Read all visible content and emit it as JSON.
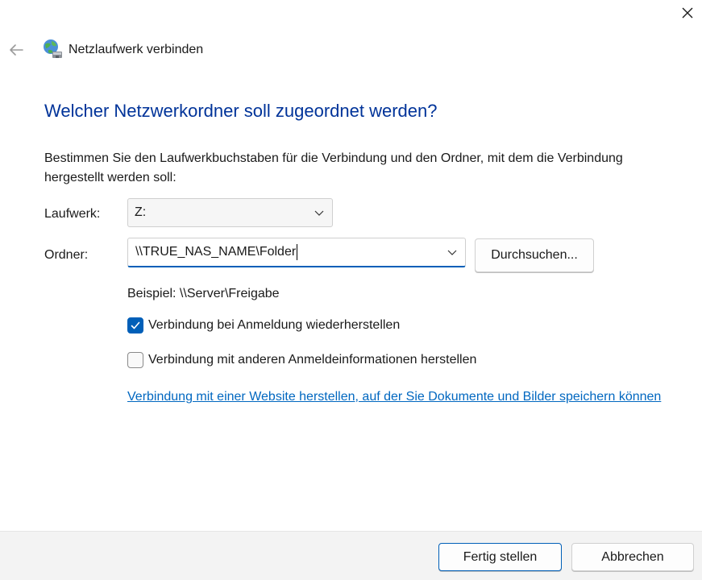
{
  "window": {
    "title": "Netzlaufwerk verbinden",
    "icon": "network-drive-icon"
  },
  "content": {
    "heading": "Welcher Netzwerkordner soll zugeordnet werden?",
    "instructions": "Bestimmen Sie den Laufwerkbuchstaben für die Verbindung und den Ordner, mit dem die Verbindung hergestellt werden soll:"
  },
  "drive": {
    "label": "Laufwerk:",
    "selected": "Z:"
  },
  "folder": {
    "label": "Ordner:",
    "value": "\\\\TRUE_NAS_NAME\\Folder",
    "browse_label": "Durchsuchen..."
  },
  "example": "Beispiel: \\\\Server\\Freigabe",
  "options": {
    "reconnect": {
      "label": "Verbindung bei Anmeldung wiederherstellen",
      "checked": true
    },
    "other_credentials": {
      "label": "Verbindung mit anderen Anmeldeinformationen herstellen",
      "checked": false
    }
  },
  "website_link": "Verbindung mit einer Website herstellen, auf der Sie Dokumente und Bilder speichern können",
  "footer": {
    "finish_label": "Fertig stellen",
    "cancel_label": "Abbrechen"
  },
  "colors": {
    "heading": "#003399",
    "accent": "#005fb8",
    "link": "#0067c0"
  }
}
